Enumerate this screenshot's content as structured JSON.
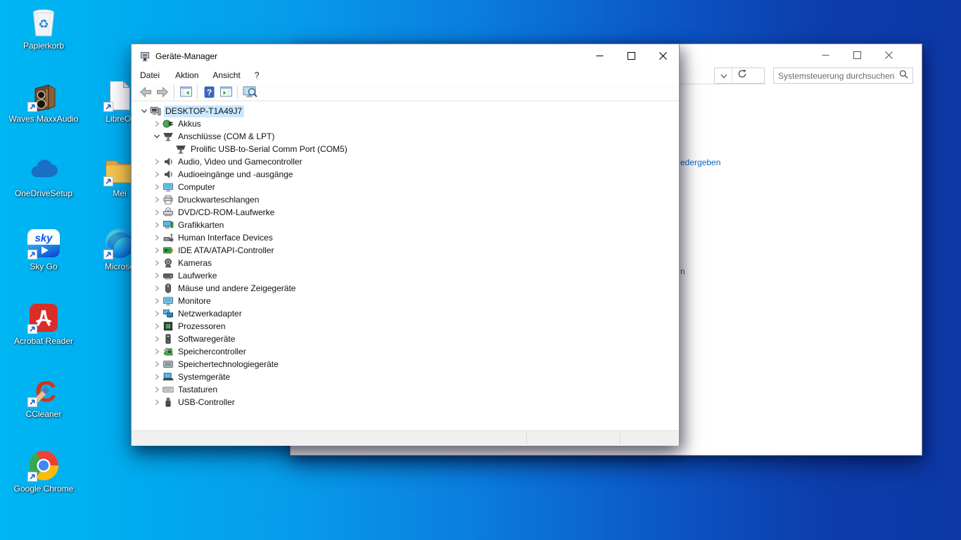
{
  "desktop": {
    "sky_logo_text": "sky",
    "colors": {
      "wallpaper_left": "#00b6f3",
      "wallpaper_right": "#0d38a6"
    },
    "icons": {
      "column1": [
        {
          "label": "Papierkorb",
          "icon": "recycle-bin",
          "shortcut": false
        },
        {
          "label": "Waves MaxxAudio",
          "icon": "waves-speaker",
          "shortcut": true
        },
        {
          "label": "OneDriveSetup",
          "icon": "onedrive-cloud",
          "shortcut": false
        },
        {
          "label": "Sky Go",
          "icon": "sky-go",
          "shortcut": true
        },
        {
          "label": "Acrobat Reader",
          "icon": "acrobat",
          "shortcut": true
        },
        {
          "label": "CCleaner",
          "icon": "ccleaner",
          "shortcut": true
        },
        {
          "label": "Google Chrome",
          "icon": "chrome",
          "shortcut": true
        }
      ],
      "column2": [
        {
          "label": "LibreOf",
          "icon": "libreoffice-doc",
          "shortcut": true
        },
        {
          "label": "Mei",
          "icon": "folder",
          "shortcut": true
        },
        {
          "label": "Microso",
          "icon": "edge",
          "shortcut": true
        }
      ]
    }
  },
  "control_panel_window": {
    "search_text": "Systemsteuerung durchsuchen",
    "toolbar_icons": [
      "chevron-down",
      "refresh",
      "search"
    ],
    "window_control_icons": [
      "minimize",
      "maximize",
      "close"
    ],
    "link_fragments": [
      "edergeben",
      "n"
    ]
  },
  "device_manager": {
    "window_title": "Geräte-Manager",
    "window_control_icons": [
      "minimize",
      "maximize",
      "close"
    ],
    "menu_items": [
      "Datei",
      "Aktion",
      "Ansicht",
      "?"
    ],
    "toolbar_icons": [
      "back-arrow",
      "forward-arrow",
      "show-console-tree",
      "help",
      "properties",
      "scan-hardware"
    ],
    "selected_item": "DESKTOP-T1A49J7",
    "tree_items": [
      {
        "label": "DESKTOP-T1A49J7",
        "level": 0,
        "chevron": "expanded",
        "icon": "computer",
        "selected": true
      },
      {
        "label": "Akkus",
        "level": 1,
        "chevron": "collapsed",
        "icon": "battery"
      },
      {
        "label": "Anschlüsse (COM & LPT)",
        "level": 1,
        "chevron": "expanded",
        "icon": "serial-port"
      },
      {
        "label": "Prolific USB-to-Serial Comm Port (COM5)",
        "level": 2,
        "chevron": "none",
        "icon": "serial-port"
      },
      {
        "label": "Audio, Video und Gamecontroller",
        "level": 1,
        "chevron": "collapsed",
        "icon": "speaker"
      },
      {
        "label": "Audioeingänge und -ausgänge",
        "level": 1,
        "chevron": "collapsed",
        "icon": "speaker"
      },
      {
        "label": "Computer",
        "level": 1,
        "chevron": "collapsed",
        "icon": "monitor"
      },
      {
        "label": "Druckwarteschlangen",
        "level": 1,
        "chevron": "collapsed",
        "icon": "printer"
      },
      {
        "label": "DVD/CD-ROM-Laufwerke",
        "level": 1,
        "chevron": "collapsed",
        "icon": "disc-drive"
      },
      {
        "label": "Grafikkarten",
        "level": 1,
        "chevron": "collapsed",
        "icon": "gpu"
      },
      {
        "label": "Human Interface Devices",
        "level": 1,
        "chevron": "collapsed",
        "icon": "hid"
      },
      {
        "label": "IDE ATA/ATAPI-Controller",
        "level": 1,
        "chevron": "collapsed",
        "icon": "ide"
      },
      {
        "label": "Kameras",
        "level": 1,
        "chevron": "collapsed",
        "icon": "camera"
      },
      {
        "label": "Laufwerke",
        "level": 1,
        "chevron": "collapsed",
        "icon": "hdd"
      },
      {
        "label": "Mäuse und andere Zeigegeräte",
        "level": 1,
        "chevron": "collapsed",
        "icon": "mouse"
      },
      {
        "label": "Monitore",
        "level": 1,
        "chevron": "collapsed",
        "icon": "monitor"
      },
      {
        "label": "Netzwerkadapter",
        "level": 1,
        "chevron": "collapsed",
        "icon": "network"
      },
      {
        "label": "Prozessoren",
        "level": 1,
        "chevron": "collapsed",
        "icon": "cpu"
      },
      {
        "label": "Softwaregeräte",
        "level": 1,
        "chevron": "collapsed",
        "icon": "software"
      },
      {
        "label": "Speichercontroller",
        "level": 1,
        "chevron": "collapsed",
        "icon": "storage-controller"
      },
      {
        "label": "Speichertechnologiegeräte",
        "level": 1,
        "chevron": "collapsed",
        "icon": "storage-tech"
      },
      {
        "label": "Systemgeräte",
        "level": 1,
        "chevron": "collapsed",
        "icon": "system"
      },
      {
        "label": "Tastaturen",
        "level": 1,
        "chevron": "collapsed",
        "icon": "keyboard"
      },
      {
        "label": "USB-Controller",
        "level": 1,
        "chevron": "collapsed",
        "icon": "usb"
      }
    ]
  }
}
